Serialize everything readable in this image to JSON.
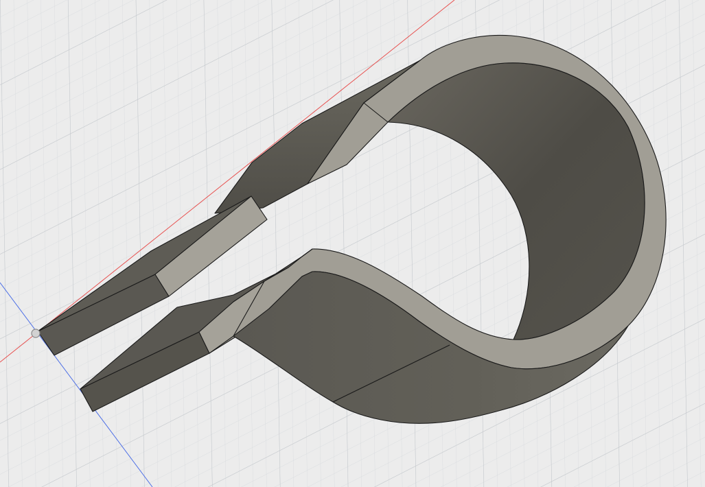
{
  "viewport": {
    "background_color": "#ececec",
    "grid_minor_color": "#d9dcdf",
    "grid_major_color": "#c3c7cb",
    "x_axis_color": "#e8504f",
    "z_axis_color": "#4d6fe6"
  },
  "model": {
    "inner_surface_color": "#55534c",
    "inner_dark_color": "#46443e",
    "outer_surface_color": "#5e5c55",
    "top_face_color": "#a19e95",
    "end_face_color": "#a5a299",
    "side_face_color": "#5a5852",
    "edge_color": "#1a1a1a"
  },
  "origin": {
    "icon": "origin-point-icon",
    "color": "#8a8a8a"
  }
}
